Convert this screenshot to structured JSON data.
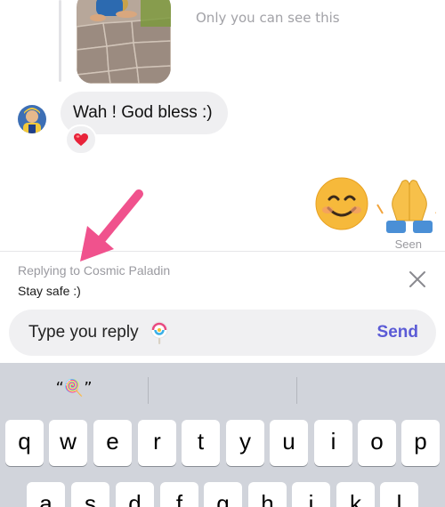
{
  "thread": {
    "private_note": "Only you can see this",
    "incoming_message": "Wah ! God bless :)",
    "reaction_emoji": "heart",
    "outgoing_emojis": [
      "smiling-face",
      "folded-hands"
    ],
    "seen_label": "Seen"
  },
  "reply_banner": {
    "replying_to": "Replying to Cosmic Paladin",
    "quoted_text": "Stay safe :)"
  },
  "composer": {
    "text": "Type you reply",
    "send_label": "Send"
  },
  "keyboard": {
    "suggestion": "“🍭”",
    "row1": [
      "q",
      "w",
      "e",
      "r",
      "t",
      "y",
      "u",
      "i",
      "o",
      "p"
    ],
    "row2": [
      "a",
      "s",
      "d",
      "f",
      "g",
      "h",
      "j",
      "k",
      "l"
    ]
  },
  "colors": {
    "accent": "#5b5bd6",
    "arrow": "#f0528d",
    "bubble": "#efeff1",
    "keyboard_bg": "#d1d4db"
  }
}
